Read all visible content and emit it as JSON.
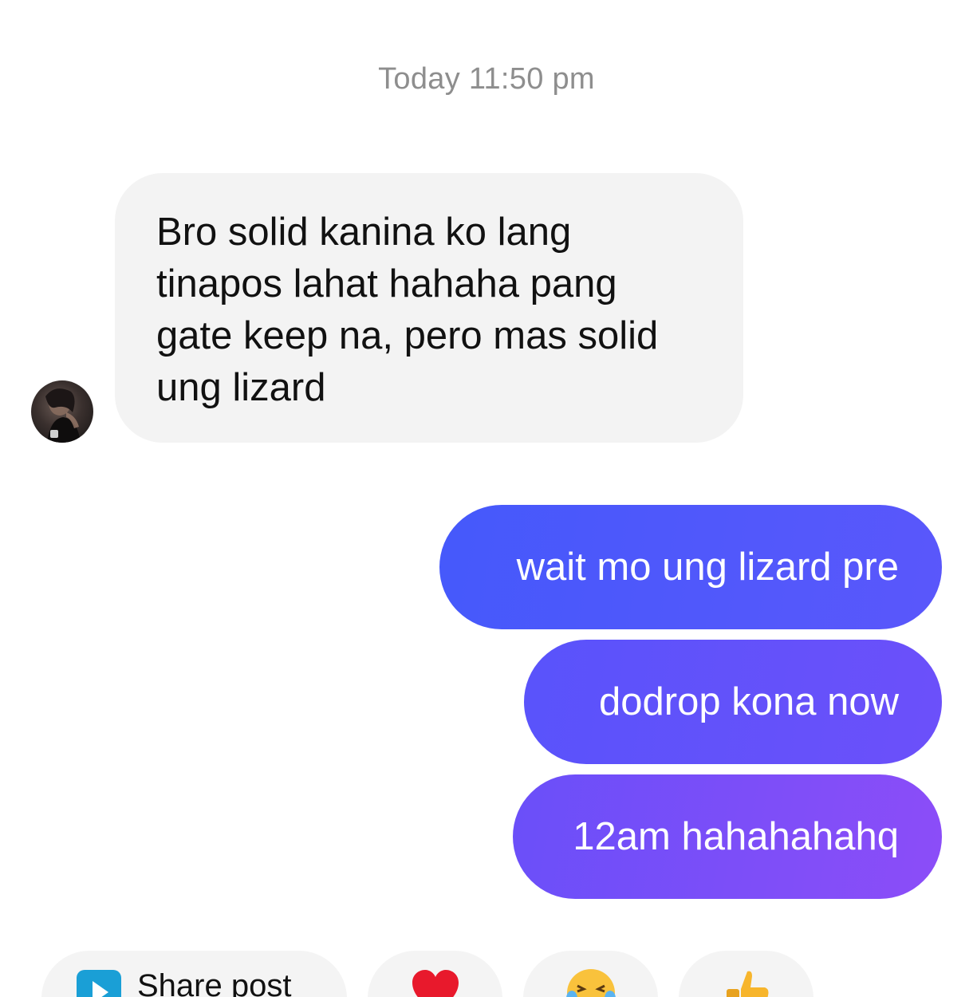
{
  "thread": {
    "timestamp": "Today 11:50 pm"
  },
  "incoming": {
    "message": "Bro solid kanina ko lang tinapos lahat hahaha pang gate keep na, pero mas solid ung lizard",
    "bubble_color": "#f3f3f3"
  },
  "outgoing": {
    "messages": [
      "wait mo ung lizard pre",
      "dodrop kona now",
      "12am hahahahahq"
    ],
    "gradient_start": "#4559fb",
    "gradient_end": "#8c4df8"
  },
  "quick_actions": {
    "share_label": "Share post",
    "share_icon": "play-square-icon",
    "reactions": [
      "heart-emoji",
      "laughing-tears-emoji",
      "thumbs-up-emoji"
    ]
  }
}
